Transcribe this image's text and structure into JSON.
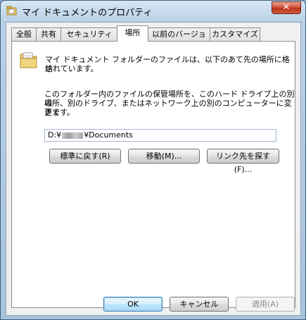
{
  "window": {
    "title": "マイ ドキュメントのプロパティ",
    "close_glyph": "✕"
  },
  "tabs": [
    "全般",
    "共有",
    "セキュリティ",
    "場所",
    "以前のバージョン",
    "カスタマイズ"
  ],
  "active_tab": "場所",
  "location": {
    "description_line1": "マイ ドキュメント フォルダーのファイルは、以下のあて先の場所に格納",
    "description_line2": "されています。",
    "info_line1": "このフォルダー内のファイルの保管場所を、このハード ドライブ上の別の",
    "info_line2": "場所、別のドライブ、またはネットワーク上の別のコンピューターに変更で",
    "info_line3": "きます。",
    "path_prefix": "D:¥",
    "path_suffix": "¥Documents",
    "restore_default_label": "標準に戻す(R)",
    "move_label": "移動(M)...",
    "find_target_label": "リンク先を探す(F)..."
  },
  "footer": {
    "ok_label": "OK",
    "cancel_label": "キャンセル",
    "apply_label": "適用(A)"
  }
}
